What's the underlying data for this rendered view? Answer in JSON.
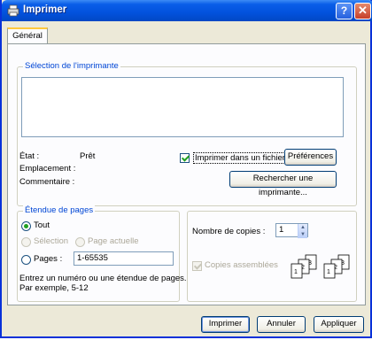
{
  "window": {
    "title": "Imprimer",
    "help_label": "?",
    "close_label": "✕"
  },
  "tabs": [
    {
      "label": "Général"
    }
  ],
  "printer_selection": {
    "group_label": "Sélection de l'imprimante",
    "state_label": "État :",
    "state_value": "Prêt",
    "location_label": "Emplacement :",
    "comment_label": "Commentaire :",
    "print_to_file_label": "Imprimer dans un fichier",
    "print_to_file_checked": true,
    "preferences_button": "Préférences",
    "find_printer_button": "Rechercher une imprimante..."
  },
  "page_range": {
    "group_label": "Étendue de pages",
    "all_label": "Tout",
    "selection_label": "Sélection",
    "current_page_label": "Page actuelle",
    "pages_label": "Pages :",
    "pages_value": "1-65535",
    "hint_line1": "Entrez un numéro ou une étendue de pages.",
    "hint_line2": "Par exemple, 5-12",
    "selected": "all"
  },
  "copies": {
    "number_label": "Nombre de copies :",
    "number_value": "1",
    "collate_label": "Copies assemblées",
    "collate_checked": true,
    "collate_disabled": true,
    "page_numbers": [
      "1",
      "2",
      "3"
    ]
  },
  "buttons": {
    "print": "Imprimer",
    "cancel": "Annuler",
    "apply": "Appliquer"
  },
  "colors": {
    "title_bar": "#0252dd",
    "group_label": "#0046d5",
    "dialog_bg": "#ece9d8"
  }
}
